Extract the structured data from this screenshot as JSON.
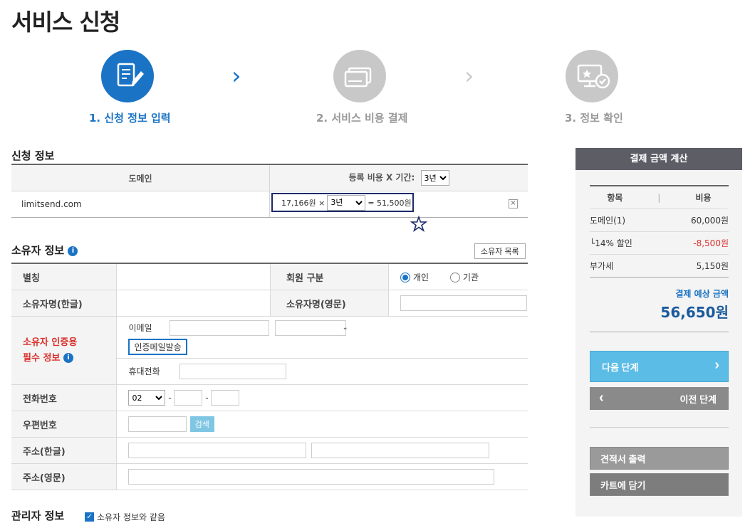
{
  "page_title": "서비스 신청",
  "steps": [
    {
      "label": "1. 신청 정보 입력",
      "active": true
    },
    {
      "label": "2. 서비스 비용 결제",
      "active": false
    },
    {
      "label": "3. 정보 확인",
      "active": false
    }
  ],
  "apply_info": {
    "title": "신청 정보",
    "col_domain": "도메인",
    "col_fee": "등록 비용 X 기간:",
    "period_header": "3년",
    "domain": "limitsend.com",
    "unit_price": "17,166원 ×",
    "period_row": "3년",
    "total": "= 51,500원",
    "remove": "×"
  },
  "owner_info": {
    "title": "소유자 정보",
    "list_button": "소유자 목록",
    "alias_label": "별칭",
    "member_type_label": "회원 구분",
    "member_type_options": [
      "개인",
      "기관"
    ],
    "name_kr_label": "소유자명(한글)",
    "name_en_label": "소유자명(영문)",
    "auth_label_line1": "소유자 인증용",
    "auth_label_line2": "필수 정보",
    "email_label": "이메일",
    "verify_button": "인증메일발송",
    "mobile_label": "휴대전화",
    "phone_label": "전화번호",
    "phone_area": "02",
    "phone_sep": "-",
    "zip_label": "우편번호",
    "zip_search": "검색",
    "addr_kr_label": "주소(한글)",
    "addr_en_label": "주소(영문)"
  },
  "admin_info": {
    "title": "관리자 정보",
    "same_as_owner": "소유자 정보와 같음"
  },
  "payment": {
    "title": "결제 금액 계산",
    "col_item": "항목",
    "col_cost": "비용",
    "rows": [
      {
        "item": "도메인(1)",
        "cost": "60,000원"
      },
      {
        "item": "└14% 할인",
        "cost": "-8,500원"
      },
      {
        "item": "부가세",
        "cost": "5,150원"
      }
    ],
    "expected_label": "결제 예상 금액",
    "expected_amount": "56,650원",
    "next_button": "다음 단계",
    "prev_button": "이전 단계",
    "quote_button": "견적서 출력",
    "cart_button": "카트에 담기"
  },
  "colors": {
    "accent": "#1a73c5",
    "inactive": "#c8c8c8",
    "discount": "#d9302c",
    "next_btn": "#5bbce6"
  }
}
